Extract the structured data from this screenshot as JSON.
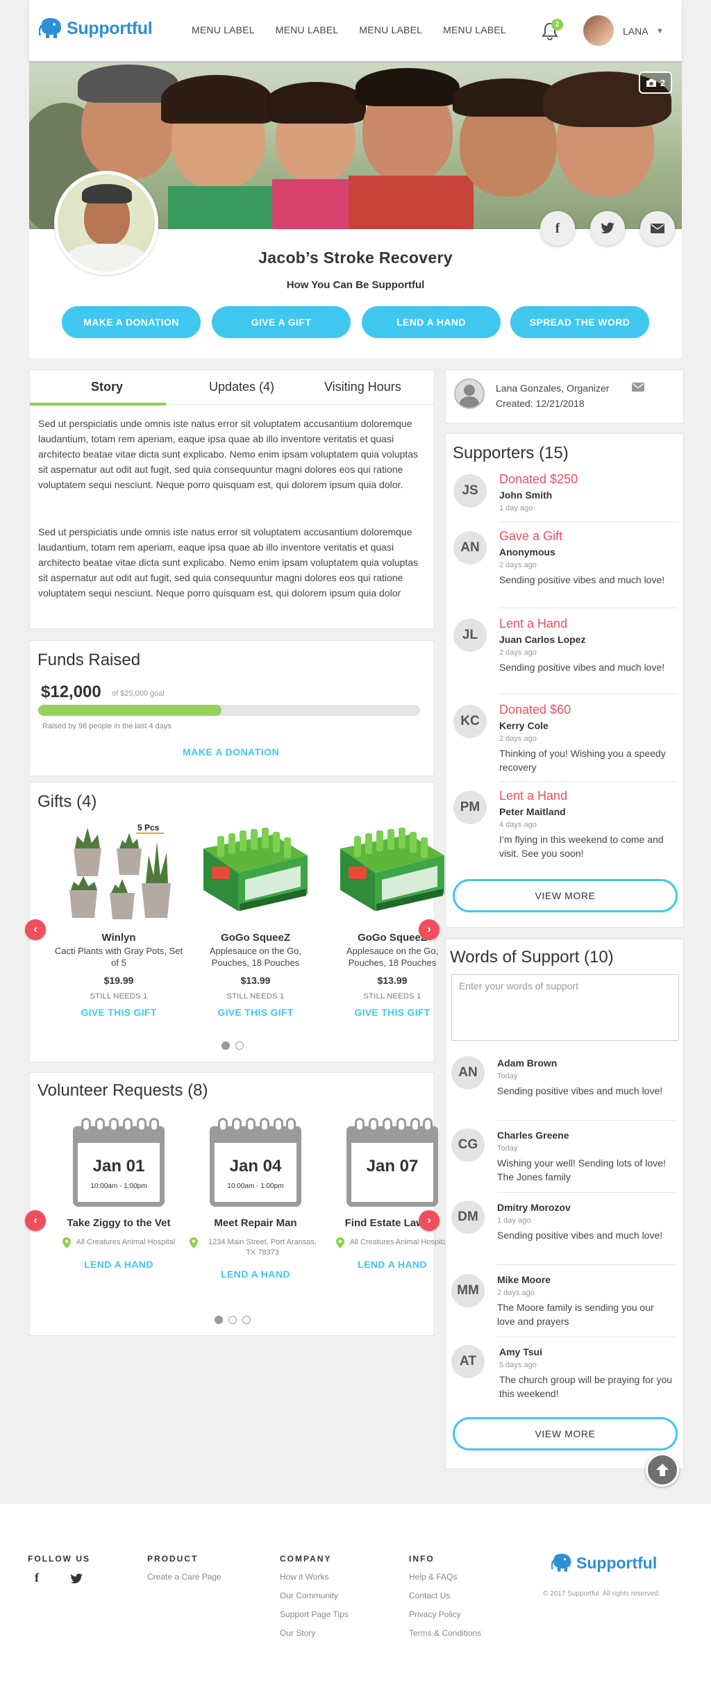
{
  "brand": {
    "name": "Supportful",
    "color": "#2d8fd5"
  },
  "nav": {
    "items": [
      "MENU LABEL",
      "MENU LABEL",
      "MENU LABEL",
      "MENU LABEL"
    ]
  },
  "header": {
    "notification_count": "2",
    "user_name": "LANA"
  },
  "hero": {
    "photo_count": "2",
    "title": "Jacob’s Stroke Recovery",
    "subtitle": "How You Can Be Supportful",
    "buttons": [
      "MAKE A DONATION",
      "GIVE A GIFT",
      "LEND A HAND",
      "SPREAD THE WORD"
    ],
    "accent": "#3fc7ef"
  },
  "story": {
    "tabs": [
      "Story",
      "Updates (4)",
      "Visiting Hours"
    ],
    "active_tab": "Story",
    "paragraphs": [
      "Sed ut perspiciatis unde omnis iste natus error sit voluptatem accusantium doloremque laudantium, totam rem aperiam, eaque ipsa quae ab illo inventore veritatis et quasi architecto beatae vitae dicta sunt explicabo. Nemo enim ipsam voluptatem quia voluptas sit aspernatur aut odit aut fugit, sed quia consequuntur magni dolores eos qui ratione voluptatem sequi nesciunt. Neque porro quisquam est, qui dolorem ipsum quia dolor.",
      "Sed ut perspiciatis unde omnis iste natus error sit voluptatem accusantium doloremque laudantium, totam rem aperiam, eaque ipsa quae ab illo inventore veritatis et quasi architecto beatae vitae dicta sunt explicabo. Nemo enim ipsam voluptatem quia voluptas sit aspernatur aut odit aut fugit, sed quia consequuntur magni dolores eos qui ratione voluptatem sequi nesciunt. Neque porro quisquam est, qui dolorem ipsum quia dolor"
    ]
  },
  "funds": {
    "title": "Funds Raised",
    "amount": "$12,000",
    "goal": "of $25,000 goal",
    "progress_fraction": 0.48,
    "raised_by": "Raised by 98 people in the last 4 days",
    "cta": "MAKE A DONATION",
    "bar_color": "#97d15c"
  },
  "gifts": {
    "title": "Gifts (4)",
    "badge": "5 Pcs",
    "items": [
      {
        "name": "Winlyn",
        "desc": "Cacti Plants with Gray Pots, Set of 5",
        "price": "$19.99",
        "needs": "STILL NEEDS 1",
        "cta": "GIVE THIS GIFT"
      },
      {
        "name": "GoGo SqueeZ",
        "desc": "Applesauce on the Go, Pouches, 18 Pouches",
        "price": "$13.99",
        "needs": "STILL NEEDS 1",
        "cta": "GIVE THIS GIFT"
      },
      {
        "name": "GoGo SqueeZ",
        "desc": "Applesauce on the Go, Pouches, 18 Pouches",
        "price": "$13.99",
        "needs": "STILL NEEDS 1",
        "cta": "GIVE THIS GIFT"
      }
    ]
  },
  "volunteer": {
    "title": "Volunteer Requests (8)",
    "items": [
      {
        "date": "Jan 01",
        "time": "10:00am - 1:00pm",
        "name": "Take Ziggy to the Vet",
        "location": "All Creatures Animal Hospital",
        "cta": "LEND A HAND"
      },
      {
        "date": "Jan 04",
        "time": "10:00am - 1:00pm",
        "name": "Meet Repair Man",
        "location": "1234 Main Street, Port Aransas, TX 78373",
        "cta": "LEND A HAND"
      },
      {
        "date": "Jan 07",
        "time": "",
        "name": "Find Estate Lawyer",
        "location": "All Creatures Animal Hospital",
        "cta": "LEND A HAND"
      }
    ]
  },
  "organizer": {
    "line1": "Lana Gonzales, Organizer",
    "line2": "Created: 12/21/2018"
  },
  "supporters": {
    "title": "Supporters (15)",
    "items": [
      {
        "initials": "JS",
        "action": "Donated $250",
        "name": "John Smith",
        "time": "1 day ago",
        "msg": ""
      },
      {
        "initials": "AN",
        "action": "Gave a Gift",
        "name": "Anonymous",
        "time": "2 days ago",
        "msg": "Sending positive vibes and much love!"
      },
      {
        "initials": "JL",
        "action": "Lent a Hand",
        "name": "Juan Carlos Lopez",
        "time": "2 days ago",
        "msg": "Sending positive vibes and much love!"
      },
      {
        "initials": "KC",
        "action": "Donated $60",
        "name": "Kerry Cole",
        "time": "2 days ago",
        "msg": "Thinking of you! Wishing you a speedy recovery"
      },
      {
        "initials": "PM",
        "action": "Lent a Hand",
        "name": "Peter Maitland",
        "time": "4 days ago",
        "msg": "I’m flying in this weekend to come and visit. See you soon!"
      }
    ],
    "cta": "VIEW MORE",
    "action_color": "#ef4f5c"
  },
  "words": {
    "title": "Words of Support (10)",
    "placeholder": "Enter your words of support",
    "items": [
      {
        "initials": "AN",
        "name": "Adam Brown",
        "time": "Today",
        "msg": "Sending positive vibes and much love!"
      },
      {
        "initials": "CG",
        "name": "Charles Greene",
        "time": "Today",
        "msg": "Wishing your well! Sending lots of love! The Jones family"
      },
      {
        "initials": "DM",
        "name": "Dmitry Morozov",
        "time": "1 day ago",
        "msg": "Sending positive vibes and much love!"
      },
      {
        "initials": "MM",
        "name": "Mike Moore",
        "time": "2 days ago",
        "msg": "The Moore family is sending you our love and prayers"
      },
      {
        "initials": "AT",
        "name": "Amy Tsui",
        "time": "5 days ago",
        "msg": "The church group will be praying for you this weekend!"
      }
    ],
    "cta": "VIEW MORE"
  },
  "footer": {
    "follow": "FOLLOW US",
    "product": {
      "head": "PRODUCT",
      "links": [
        "Create a Care Page"
      ]
    },
    "company": {
      "head": "COMPANY",
      "links": [
        "How it Works",
        "Our Community",
        "Support Page Tips",
        "Our Story"
      ]
    },
    "info": {
      "head": "INFO",
      "links": [
        "Help & FAQs",
        "Contact Us",
        "Privacy Policy",
        "Terms & Conditions"
      ]
    },
    "copyright": "© 2017 Supportful. All rights reserved."
  }
}
